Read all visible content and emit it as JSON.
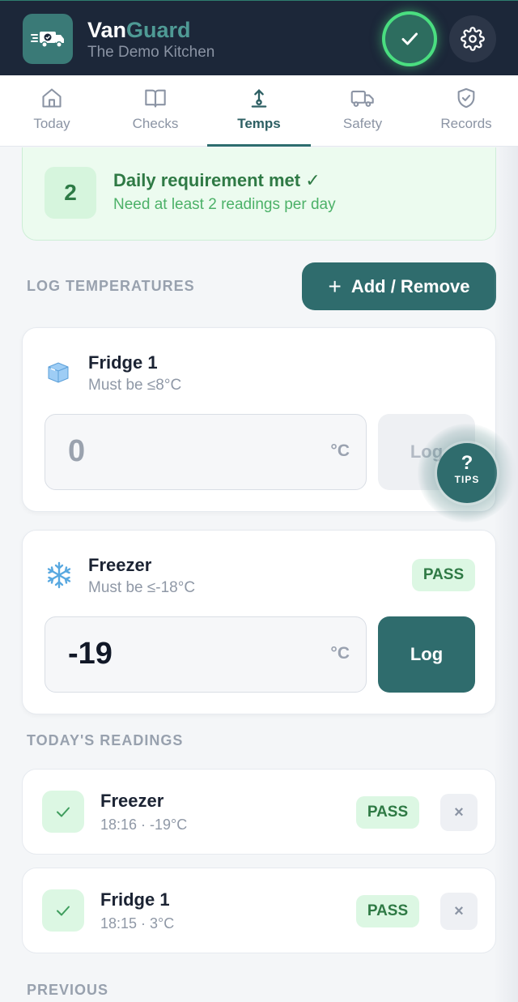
{
  "header": {
    "brand_part1": "Van",
    "brand_part2": "Guard",
    "subtitle": "The Demo Kitchen",
    "status_icon": "check-icon",
    "settings_icon": "gear-icon"
  },
  "tabs": [
    {
      "label": "Today",
      "icon": "home-icon",
      "active": false
    },
    {
      "label": "Checks",
      "icon": "book-icon",
      "active": false
    },
    {
      "label": "Temps",
      "icon": "thermometer-icon",
      "active": true
    },
    {
      "label": "Safety",
      "icon": "truck-icon",
      "active": false
    },
    {
      "label": "Records",
      "icon": "shield-check-icon",
      "active": false
    }
  ],
  "banner": {
    "count": "2",
    "title": "Daily requirement met ✓",
    "subtitle": "Need at least 2 readings per day"
  },
  "log_section": {
    "label": "LOG TEMPERATURES",
    "add_button": "Add / Remove"
  },
  "units": [
    {
      "name": "Fridge 1",
      "requirement": "Must be ≤8°C",
      "value": "0",
      "unit": "°C",
      "log_label": "Log",
      "icon": "ice-cube-icon"
    },
    {
      "name": "Freezer",
      "requirement": "Must be ≤-18°C",
      "value": "-19",
      "unit": "°C",
      "log_label": "Log",
      "status": "PASS",
      "icon": "snowflake-icon"
    }
  ],
  "tips": {
    "symbol": "?",
    "label": "TIPS"
  },
  "readings_section": {
    "label": "TODAY'S READINGS"
  },
  "readings": [
    {
      "name": "Freezer",
      "meta": "18:16 · -19°C",
      "status": "PASS",
      "delete": "×"
    },
    {
      "name": "Fridge 1",
      "meta": "18:15 · 3°C",
      "status": "PASS",
      "delete": "×"
    }
  ],
  "previous_section": {
    "label": "PREVIOUS"
  },
  "colors": {
    "header_bg": "#1c2739",
    "accent": "#2f6c6d",
    "pass_green": "#2f7a45",
    "banner_bg": "#ecfbef"
  }
}
